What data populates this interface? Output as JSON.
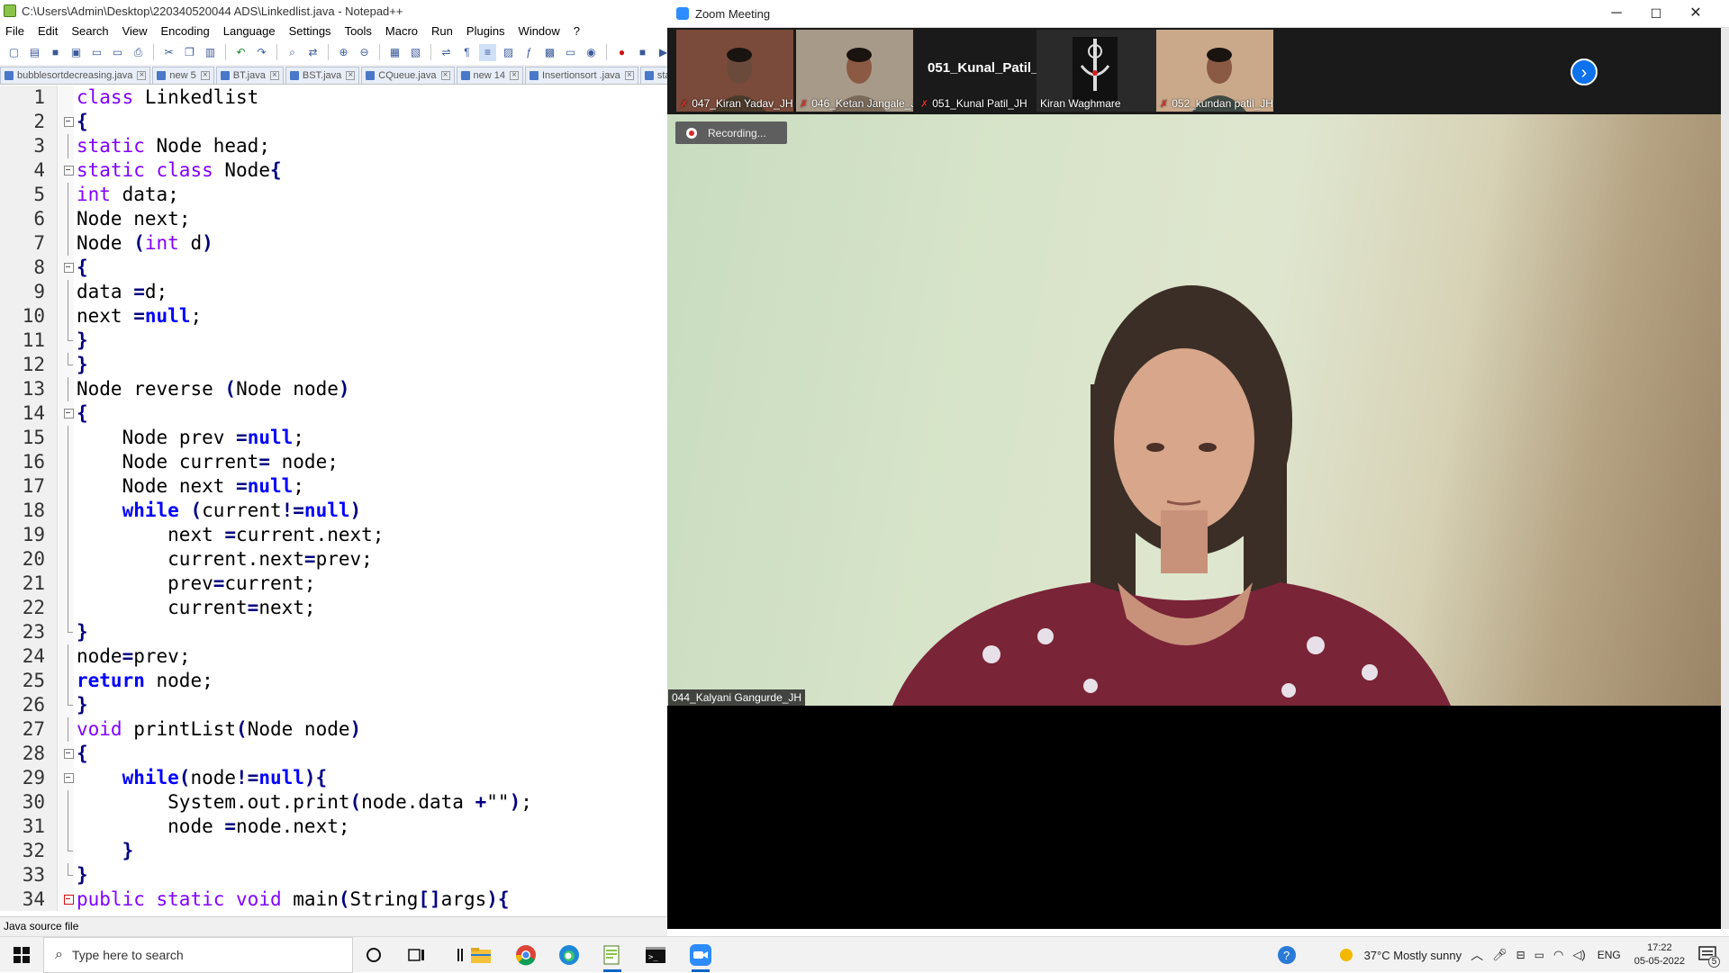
{
  "notepad": {
    "title": "C:\\Users\\Admin\\Desktop\\220340520044 ADS\\Linkedlist.java - Notepad++",
    "menu": [
      "File",
      "Edit",
      "Search",
      "View",
      "Encoding",
      "Language",
      "Settings",
      "Tools",
      "Macro",
      "Run",
      "Plugins",
      "Window",
      "?"
    ],
    "tabs": [
      {
        "label": "bubblesortdecreasing.java"
      },
      {
        "label": "new 5"
      },
      {
        "label": "BT.java"
      },
      {
        "label": "BST.java"
      },
      {
        "label": "CQueue.java"
      },
      {
        "label": "new 14"
      },
      {
        "label": "Insertionsort .java"
      },
      {
        "label": "stack"
      }
    ],
    "code_lines": [
      {
        "n": "1",
        "fold": "",
        "text": "class Linkedlist"
      },
      {
        "n": "2",
        "fold": "box",
        "text": "{"
      },
      {
        "n": "3",
        "fold": "bar",
        "text": "static Node head;"
      },
      {
        "n": "4",
        "fold": "box",
        "text": "static class Node{"
      },
      {
        "n": "5",
        "fold": "bar",
        "text": "int data;"
      },
      {
        "n": "6",
        "fold": "bar",
        "text": "Node next;"
      },
      {
        "n": "7",
        "fold": "bar",
        "text": "Node (int d)"
      },
      {
        "n": "8",
        "fold": "box",
        "text": "{"
      },
      {
        "n": "9",
        "fold": "bar",
        "text": "data =d;"
      },
      {
        "n": "10",
        "fold": "bar",
        "text": "next =null;"
      },
      {
        "n": "11",
        "fold": "end",
        "text": "}"
      },
      {
        "n": "12",
        "fold": "end",
        "text": "}"
      },
      {
        "n": "13",
        "fold": "bar",
        "text": "Node reverse (Node node)"
      },
      {
        "n": "14",
        "fold": "box",
        "text": "{"
      },
      {
        "n": "15",
        "fold": "bar",
        "text": "    Node prev =null;"
      },
      {
        "n": "16",
        "fold": "bar",
        "text": "    Node current= node;"
      },
      {
        "n": "17",
        "fold": "bar",
        "text": "    Node next =null;"
      },
      {
        "n": "18",
        "fold": "bar",
        "text": "    while (current!=null)"
      },
      {
        "n": "19",
        "fold": "bar",
        "text": "        next =current.next;"
      },
      {
        "n": "20",
        "fold": "bar",
        "text": "        current.next=prev;"
      },
      {
        "n": "21",
        "fold": "bar",
        "text": "        prev=current;"
      },
      {
        "n": "22",
        "fold": "bar",
        "text": "        current=next;"
      },
      {
        "n": "23",
        "fold": "end",
        "text": "}"
      },
      {
        "n": "24",
        "fold": "bar",
        "text": "node=prev;"
      },
      {
        "n": "25",
        "fold": "bar",
        "text": "return node;"
      },
      {
        "n": "26",
        "fold": "end",
        "text": "}"
      },
      {
        "n": "27",
        "fold": "bar",
        "text": "void printList(Node node)"
      },
      {
        "n": "28",
        "fold": "box",
        "text": "{"
      },
      {
        "n": "29",
        "fold": "box",
        "text": "    while(node!=null){"
      },
      {
        "n": "30",
        "fold": "bar",
        "text": "        System.out.print(node.data +\"\");"
      },
      {
        "n": "31",
        "fold": "bar",
        "text": "        node =node.next;"
      },
      {
        "n": "32",
        "fold": "end",
        "text": "    }"
      },
      {
        "n": "33",
        "fold": "end",
        "text": "}"
      },
      {
        "n": "34",
        "fold": "boxred",
        "text": "public static void main(String[]args){"
      }
    ],
    "status": "Java source file"
  },
  "zoom": {
    "title": "Zoom Meeting",
    "recording": "Recording...",
    "speaker": "044_Kalyani Gangurde_JH",
    "participants": [
      {
        "name": "047_Kiran Yadav_JH",
        "muted": true,
        "video": true,
        "color": "#7a4a3a"
      },
      {
        "name": "046_Ketan Jangale_JH",
        "muted": true,
        "video": true,
        "color": "#a89a88"
      },
      {
        "name": "051_Kunal Patil_JH",
        "muted": true,
        "video": false,
        "big_name": "051_Kunal_Patil_...",
        "color": "#1a1a1a"
      },
      {
        "name": "Kiran Waghmare",
        "muted": false,
        "video": true,
        "color": "#2a2a2a"
      },
      {
        "name": "052_kundan patil_JH",
        "muted": true,
        "video": true,
        "color": "#c9a98a"
      }
    ]
  },
  "taskbar": {
    "search_placeholder": "Type here to search",
    "weather": "37°C  Mostly sunny",
    "lang": "ENG",
    "time": "17:22",
    "date": "05-05-2022",
    "notif_count": "5"
  }
}
